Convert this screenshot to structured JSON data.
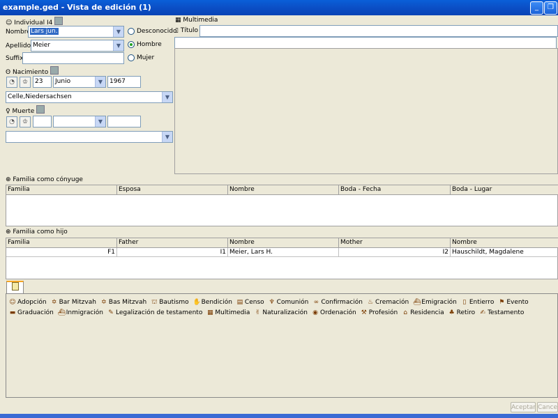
{
  "window": {
    "title": "example.ged - Vista de edición (1)"
  },
  "individual": {
    "header": "Individual I4",
    "name_label": "Nombre",
    "name_value": "Lars jun.",
    "surname_label": "Apellidos",
    "surname_value": "Meier",
    "suffix_label": "Suffix",
    "suffix_value": "",
    "sex_options": [
      "Desconocido",
      "Hombre",
      "Mujer"
    ],
    "sex_selected": "Hombre"
  },
  "birth": {
    "label": "Nacimiento",
    "day": "23",
    "month": "Junio",
    "year": "1967",
    "place": "Celle,Niedersachsen"
  },
  "death": {
    "label": "Muerte",
    "day": "",
    "month": "",
    "year": "",
    "place": ""
  },
  "multimedia": {
    "header": "Multimedia",
    "title_label": "Título",
    "title_value": "",
    "path_value": ""
  },
  "spouse_families": {
    "header": "Familia como cónyuge",
    "columns": [
      "Familia",
      "Esposa",
      "Nombre",
      "Boda - Fecha",
      "Boda - Lugar"
    ],
    "rows": []
  },
  "child_families": {
    "header": "Familia como hijo",
    "columns": [
      "Familia",
      "Father",
      "Nombre",
      "Mother",
      "Nombre"
    ],
    "rows": [
      [
        "F1",
        "I1",
        "Meier, Lars H.",
        "I2",
        "Hauschildt, Magdalene"
      ]
    ]
  },
  "events": [
    {
      "icon": "adoption-icon",
      "label": "Adopción"
    },
    {
      "icon": "star-of-david-icon",
      "label": "Bar Mitzvah"
    },
    {
      "icon": "star-of-david-icon",
      "label": "Bas Mitzvah"
    },
    {
      "icon": "baptism-icon",
      "label": "Bautismo"
    },
    {
      "icon": "blessing-icon",
      "label": "Bendición"
    },
    {
      "icon": "census-icon",
      "label": "Censo"
    },
    {
      "icon": "chalice-icon",
      "label": "Comunión"
    },
    {
      "icon": "rings-icon",
      "label": "Confirmación"
    },
    {
      "icon": "flame-icon",
      "label": "Cremación"
    },
    {
      "icon": "ship-icon",
      "label": "Emigración"
    },
    {
      "icon": "grave-icon",
      "label": "Entierro"
    },
    {
      "icon": "flag-icon",
      "label": "Evento"
    },
    {
      "icon": "graduation-cap-icon",
      "label": "Graduación"
    },
    {
      "icon": "ship-icon",
      "label": "Inmigración"
    },
    {
      "icon": "will-icon",
      "label": "Legalización de testamento"
    },
    {
      "icon": "multimedia-icon",
      "label": "Multimedia"
    },
    {
      "icon": "naturalization-icon",
      "label": "Naturalización"
    },
    {
      "icon": "ordination-icon",
      "label": "Ordenación"
    },
    {
      "icon": "occupation-icon",
      "label": "Profesión"
    },
    {
      "icon": "house-icon",
      "label": "Residencia"
    },
    {
      "icon": "retirement-icon",
      "label": "Retiro"
    },
    {
      "icon": "testament-icon",
      "label": "Testamento"
    }
  ],
  "buttons": {
    "ok": "Aceptar",
    "cancel": "Cancelar"
  }
}
